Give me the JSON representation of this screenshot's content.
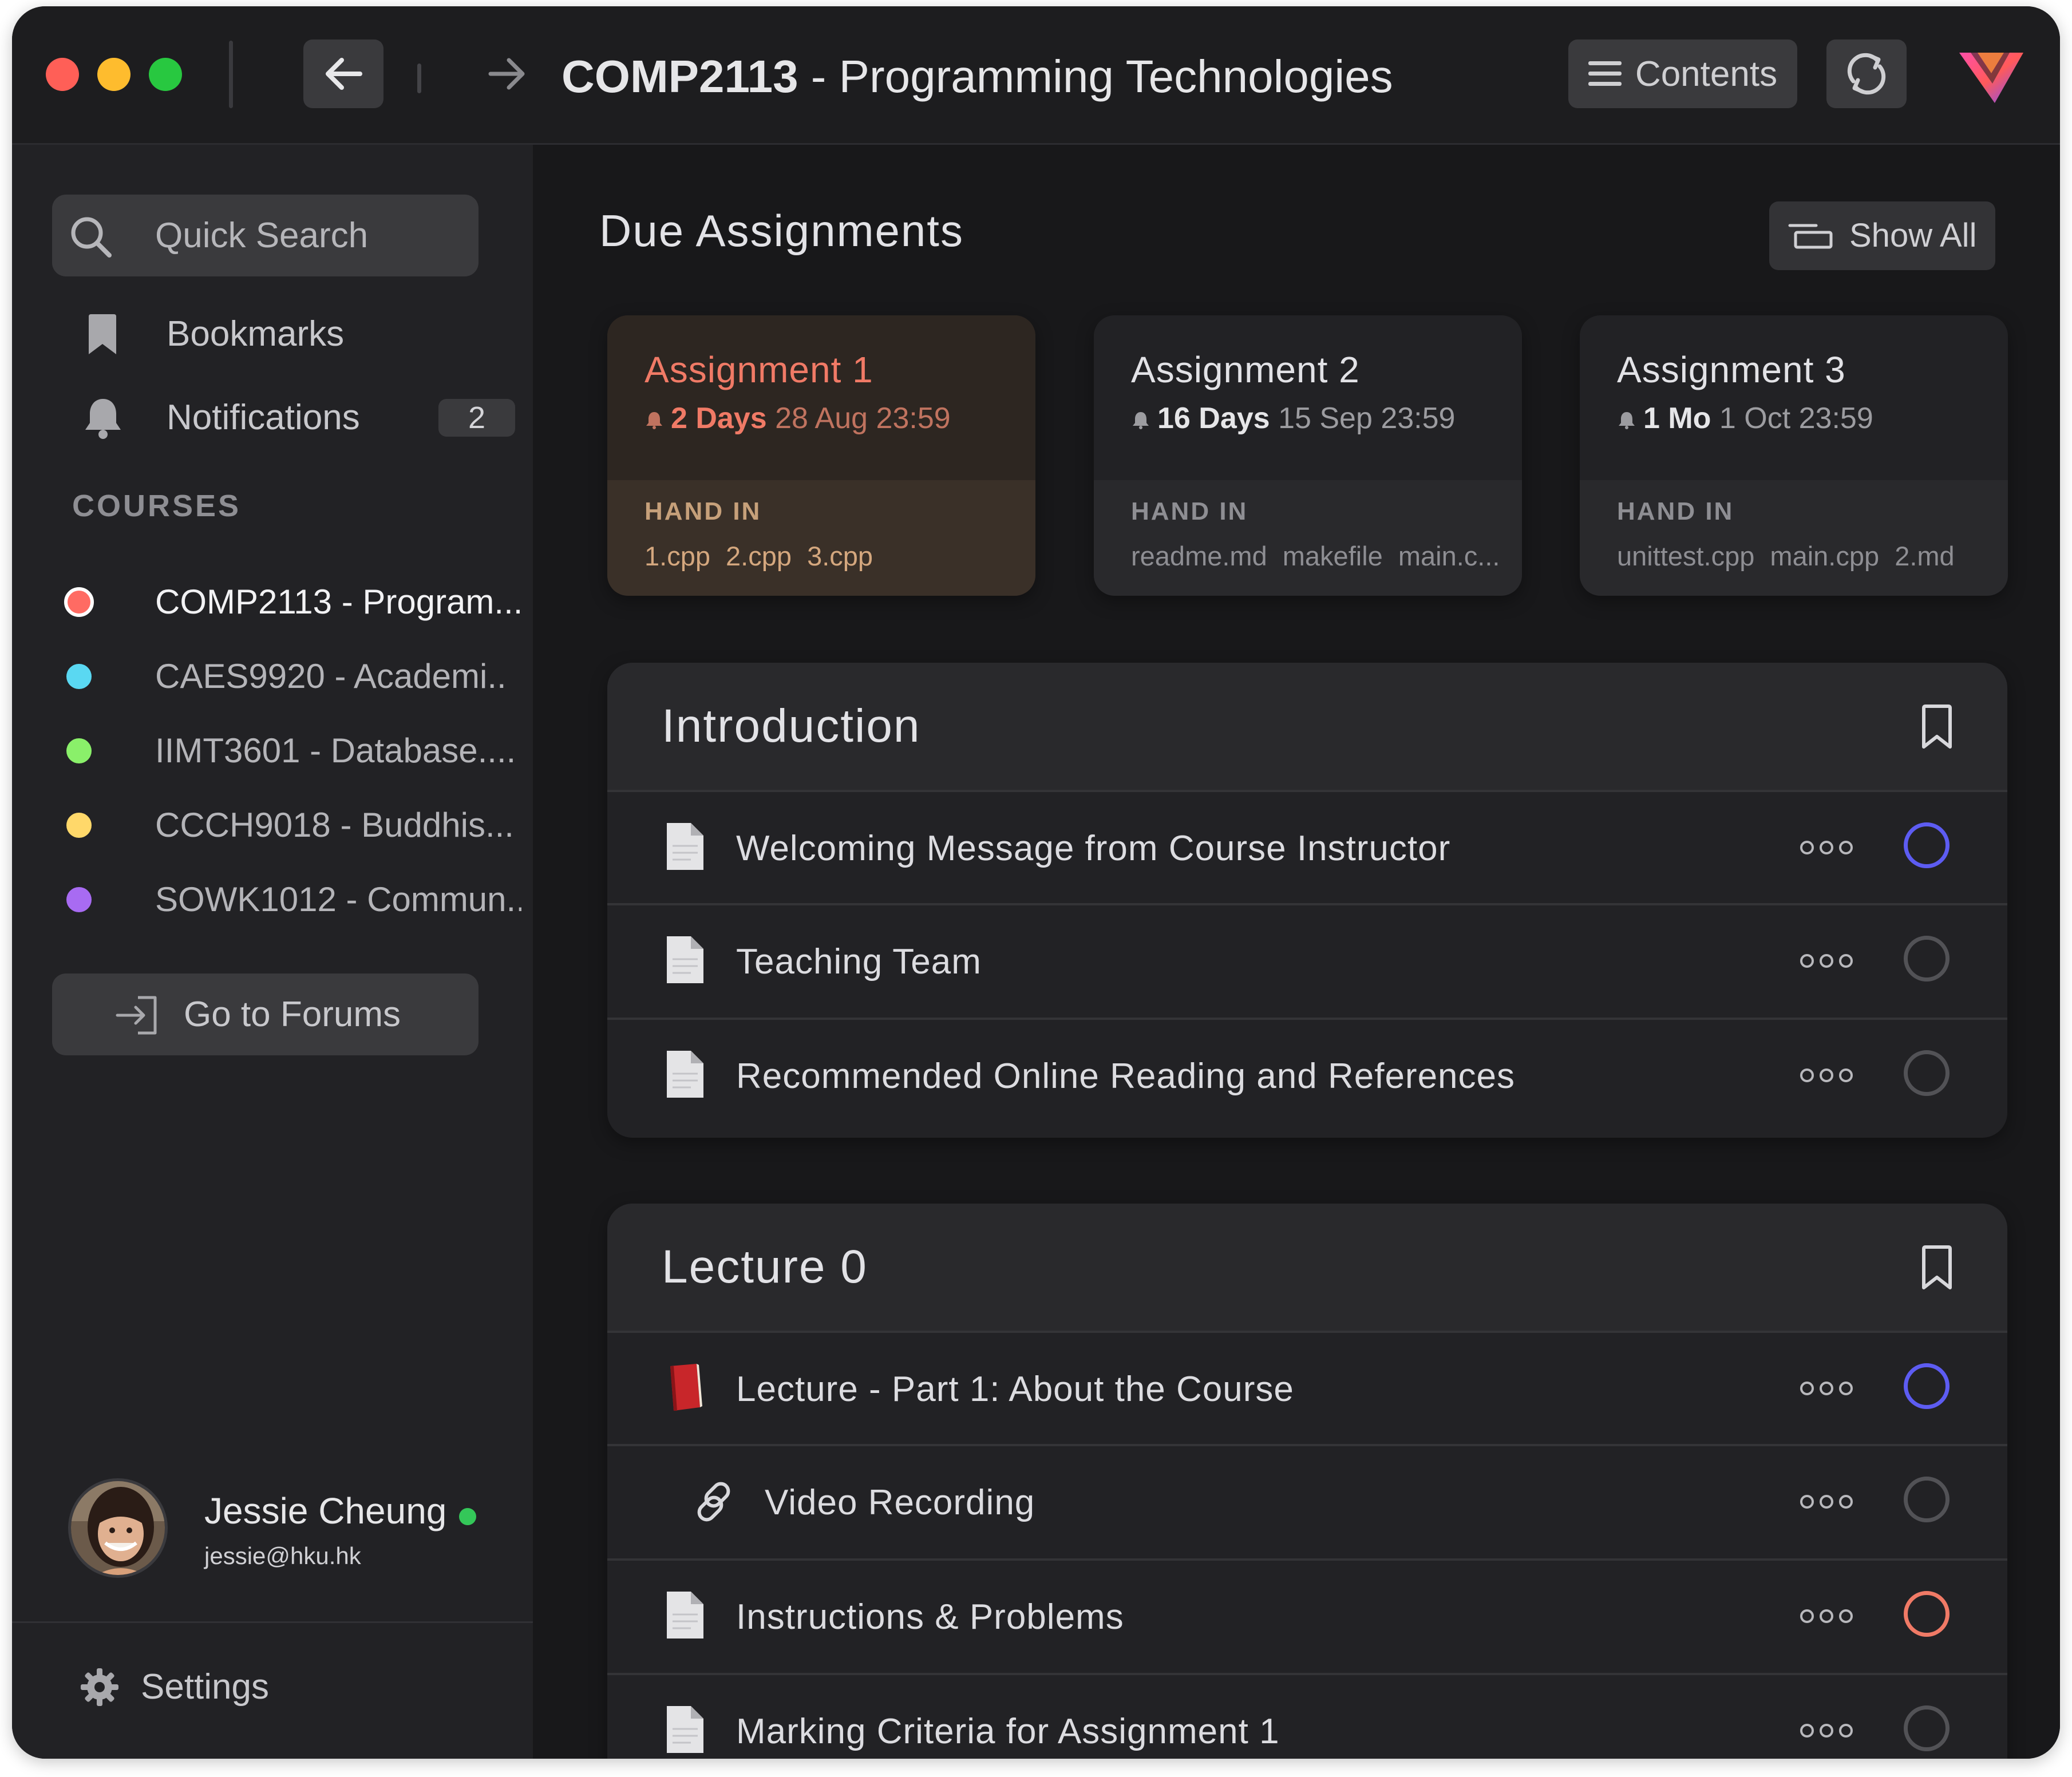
{
  "titlebar": {
    "course_code": "COMP2113",
    "course_title": " - Programming Technologies",
    "contents_label": "Contents",
    "icons": [
      "back-arrow-icon",
      "forward-arrow-icon",
      "hamburger-icon",
      "sync-icon",
      "app-logo"
    ]
  },
  "sidebar": {
    "search_label": "Quick Search",
    "bookmarks_label": "Bookmarks",
    "notifications_label": "Notifications",
    "notifications_count": "2",
    "courses_heading": "COURSES",
    "courses": [
      {
        "label": "COMP2113 - Program...",
        "color": "#ff6b63",
        "active": true
      },
      {
        "label": "CAES9920 - Academi..",
        "color": "#5ad8f2",
        "active": false
      },
      {
        "label": "IIMT3601 - Database....",
        "color": "#8af06a",
        "active": false
      },
      {
        "label": "CCCH9018 - Buddhis...",
        "color": "#ffd86a",
        "active": false
      },
      {
        "label": "SOWK1012 - Commun..",
        "color": "#a86bf2",
        "active": false
      }
    ],
    "forums_label": "Go to Forums",
    "user": {
      "name": "Jessie Cheung",
      "email": "jessie@hku.hk",
      "status_color": "#34c759"
    },
    "settings_label": "Settings"
  },
  "main": {
    "due_title": "Due Assignments",
    "show_all_label": "Show All",
    "assignments": [
      {
        "name": "Assignment 1",
        "remaining": "2 Days",
        "date": "28 Aug 23:59",
        "hand_in": "HAND IN",
        "files": "1.cpp  2.cpp  3.cpp",
        "urgent": true
      },
      {
        "name": "Assignment 2",
        "remaining": "16 Days",
        "date": "15 Sep 23:59",
        "hand_in": "HAND IN",
        "files": "readme.md  makefile  main.c...",
        "urgent": false
      },
      {
        "name": "Assignment 3",
        "remaining": "1 Mo",
        "date": "1 Oct 23:59",
        "hand_in": "HAND IN",
        "files": "unittest.cpp  main.cpp  2.md",
        "urgent": false
      }
    ],
    "sections": [
      {
        "title": "Introduction",
        "items": [
          {
            "label": "Welcoming Message from Course Instructor",
            "icon": "document-icon",
            "status": "highlighted"
          },
          {
            "label": "Teaching Team",
            "icon": "document-icon",
            "status": "default"
          },
          {
            "label": "Recommended Online Reading and References",
            "icon": "document-icon",
            "status": "default"
          }
        ]
      },
      {
        "title": "Lecture 0",
        "items": [
          {
            "label": "Lecture - Part 1: About the Course",
            "icon": "book-icon",
            "status": "highlighted"
          },
          {
            "label": "Video Recording",
            "icon": "link-icon",
            "status": "default"
          },
          {
            "label": "Instructions & Problems",
            "icon": "document-icon",
            "status": "alert"
          },
          {
            "label": "Marking Criteria for Assignment 1",
            "icon": "document-icon",
            "status": "default"
          }
        ]
      }
    ]
  },
  "colors": {
    "accent_blue": "#5d5cf2",
    "alert_salmon": "#f07a66",
    "neutral_ring": "#525256"
  }
}
